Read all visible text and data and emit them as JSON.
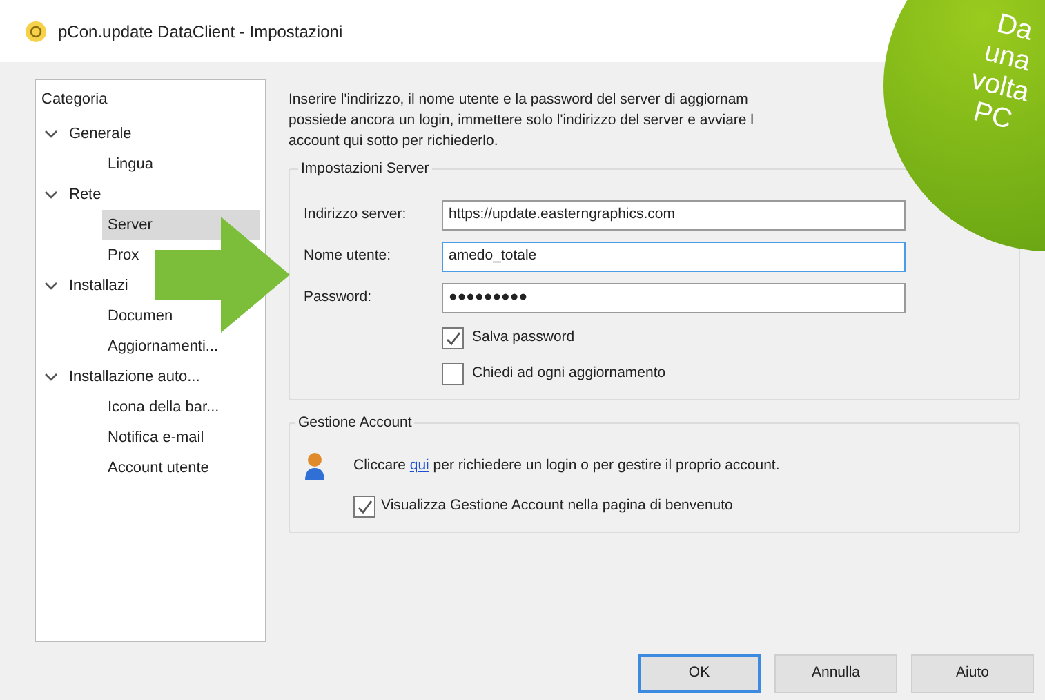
{
  "window": {
    "title": "pCon.update DataClient - Impostazioni"
  },
  "sidebar": {
    "heading": "Categoria",
    "items": [
      {
        "label": "Generale",
        "expanded": true,
        "selected": false,
        "children": [
          {
            "label": "Lingua",
            "selected": false
          }
        ]
      },
      {
        "label": "Rete",
        "expanded": true,
        "selected": false,
        "children": [
          {
            "label": "Server",
            "selected": true
          },
          {
            "label": "Prox",
            "selected": false
          }
        ]
      },
      {
        "label": "Installazi",
        "expanded": true,
        "selected": false,
        "children": [
          {
            "label": "Documen",
            "selected": false
          },
          {
            "label": "Aggiornamenti...",
            "selected": false
          }
        ]
      },
      {
        "label": "Installazione auto...",
        "expanded": true,
        "selected": false,
        "children": [
          {
            "label": "Icona della bar...",
            "selected": false
          },
          {
            "label": "Notifica e-mail",
            "selected": false
          },
          {
            "label": "Account utente",
            "selected": false
          }
        ]
      }
    ]
  },
  "intro": [
    "Inserire l'indirizzo, il nome utente e la password del server di aggiornam",
    "possiede ancora un login, immettere solo l'indirizzo del server e avviare l",
    "account qui sotto per richiederlo."
  ],
  "server_group": {
    "title": "Impostazioni Server",
    "fields": [
      {
        "label": "Indirizzo server:",
        "value": "https://update.easterngraphics.com",
        "focused": false
      },
      {
        "label": "Nome utente:",
        "value": "amedo_totale",
        "focused": true
      },
      {
        "label": "Password:",
        "value": "●●●●●●●●●",
        "focused": false
      }
    ],
    "checkboxes": [
      {
        "label": "Salva password",
        "checked": true
      },
      {
        "label": "Chiedi ad ogni aggiornamento",
        "checked": false
      }
    ]
  },
  "account_group": {
    "title": "Gestione Account",
    "text_before": "Cliccare",
    "link": "qui",
    "text_after": "per richiedere un login o per gestire il proprio account.",
    "checkbox": {
      "label": "Visualizza Gestione Account nella pagina di benvenuto",
      "checked": true
    }
  },
  "buttons": [
    {
      "label": "OK",
      "default": true
    },
    {
      "label": "Annulla",
      "default": false
    },
    {
      "label": "Aiuto",
      "default": false
    }
  ],
  "badge": {
    "lines": [
      "Da",
      "una",
      "volta",
      "PC"
    ]
  }
}
